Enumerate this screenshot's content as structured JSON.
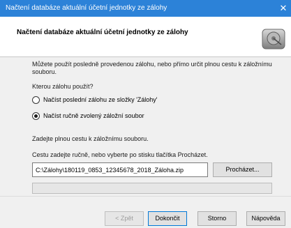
{
  "window": {
    "title": "Načtení databáze aktuální účetní jednotky ze zálohy",
    "close_glyph": "✕"
  },
  "header": {
    "title": "Načtení databáze aktuální účetní jednotky ze zálohy",
    "icon": "disk-drive-icon"
  },
  "content": {
    "intro_line1": "Můžete použít posledně provedenou zálohu, nebo přímo určit plnou cestu k záložnímu",
    "intro_line2": "souboru.",
    "question": "Kterou zálohu použít?",
    "radio_last": "Načíst poslední zálohu ze složky 'Zálohy'",
    "radio_manual": "Načíst ručně zvolený záložní soubor",
    "selected_option": "radio_manual",
    "path_prompt": "Zadejte plnou cestu k záložnímu souboru.",
    "path_hint": "Cestu zadejte ručně, nebo vyberte po stisku tlačítka Procházet.",
    "path_value": "C:\\Zálohy\\180119_0853_12345678_2018_Záloha.zip",
    "browse_label": "Procházet...",
    "progress": 0
  },
  "footer": {
    "back_label": "< Zpět",
    "finish_label": "Dokončit",
    "cancel_label": "Storno",
    "help_label": "Nápověda"
  },
  "colors": {
    "titlebar": "#2c82d8",
    "focus_border": "#0078d7"
  }
}
